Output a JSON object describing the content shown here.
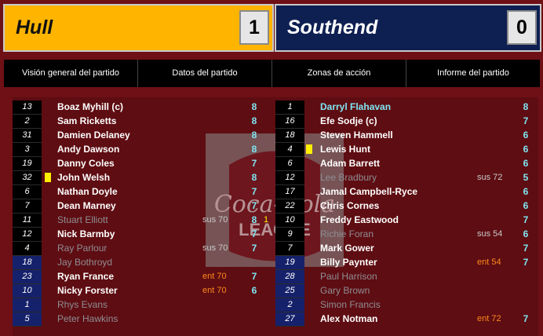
{
  "match": {
    "home": {
      "team": "Hull",
      "score": "1",
      "color": "#ffb400"
    },
    "away": {
      "team": "Southend",
      "score": "0",
      "color": "#0e1f52"
    }
  },
  "tabs": [
    "Visión general del partido",
    "Datos del partido",
    "Zonas de acción",
    "Informe del partido"
  ],
  "home_players": [
    {
      "num": "13",
      "name": "Boaz Myhill (c)",
      "event": "",
      "rating": "8",
      "style": "white",
      "bench": false,
      "card": false
    },
    {
      "num": "2",
      "name": "Sam Ricketts",
      "event": "",
      "rating": "8",
      "style": "white",
      "bench": false,
      "card": false
    },
    {
      "num": "31",
      "name": "Damien Delaney",
      "event": "",
      "rating": "8",
      "style": "white",
      "bench": false,
      "card": false
    },
    {
      "num": "3",
      "name": "Andy Dawson",
      "event": "",
      "rating": "8",
      "style": "white",
      "bench": false,
      "card": false
    },
    {
      "num": "19",
      "name": "Danny Coles",
      "event": "",
      "rating": "7",
      "style": "white",
      "bench": false,
      "card": false
    },
    {
      "num": "32",
      "name": "John Welsh",
      "event": "",
      "rating": "8",
      "style": "white",
      "bench": false,
      "card": true
    },
    {
      "num": "6",
      "name": "Nathan Doyle",
      "event": "",
      "rating": "7",
      "style": "white",
      "bench": false,
      "card": false
    },
    {
      "num": "7",
      "name": "Dean Marney",
      "event": "",
      "rating": "7",
      "style": "white",
      "bench": false,
      "card": false
    },
    {
      "num": "11",
      "name": "Stuart Elliott",
      "event": "sus 70",
      "rating": "8",
      "style": "gray",
      "bench": false,
      "card": false,
      "goal": "1"
    },
    {
      "num": "12",
      "name": "Nick Barmby",
      "event": "",
      "rating": "7",
      "style": "white",
      "bench": false,
      "card": false
    },
    {
      "num": "4",
      "name": "Ray Parlour",
      "event": "sus 70",
      "rating": "7",
      "style": "gray",
      "bench": false,
      "card": false
    },
    {
      "num": "18",
      "name": "Jay Bothroyd",
      "event": "",
      "rating": "",
      "style": "gray",
      "bench": true,
      "card": false
    },
    {
      "num": "23",
      "name": "Ryan France",
      "event": "ent 70",
      "rating": "7",
      "style": "white",
      "bench": true,
      "card": false
    },
    {
      "num": "10",
      "name": "Nicky Forster",
      "event": "ent 70",
      "rating": "6",
      "style": "white",
      "bench": true,
      "card": false
    },
    {
      "num": "1",
      "name": "Rhys Evans",
      "event": "",
      "rating": "",
      "style": "gray",
      "bench": true,
      "card": false
    },
    {
      "num": "5",
      "name": "Peter Hawkins",
      "event": "",
      "rating": "",
      "style": "gray",
      "bench": true,
      "card": false
    }
  ],
  "away_players": [
    {
      "num": "1",
      "name": "Darryl Flahavan",
      "event": "",
      "rating": "8",
      "style": "cyan",
      "bench": false,
      "card": false
    },
    {
      "num": "16",
      "name": "Efe Sodje (c)",
      "event": "",
      "rating": "7",
      "style": "white",
      "bench": false,
      "card": false
    },
    {
      "num": "18",
      "name": "Steven Hammell",
      "event": "",
      "rating": "6",
      "style": "white",
      "bench": false,
      "card": false
    },
    {
      "num": "4",
      "name": "Lewis Hunt",
      "event": "",
      "rating": "6",
      "style": "white",
      "bench": false,
      "card": true
    },
    {
      "num": "6",
      "name": "Adam Barrett",
      "event": "",
      "rating": "6",
      "style": "white",
      "bench": false,
      "card": false
    },
    {
      "num": "12",
      "name": "Lee Bradbury",
      "event": "sus 72",
      "rating": "5",
      "style": "gray",
      "bench": false,
      "card": false
    },
    {
      "num": "17",
      "name": "Jamal Campbell-Ryce",
      "event": "",
      "rating": "6",
      "style": "white",
      "bench": false,
      "card": false
    },
    {
      "num": "22",
      "name": "Chris Cornes",
      "event": "",
      "rating": "6",
      "style": "white",
      "bench": false,
      "card": false
    },
    {
      "num": "10",
      "name": "Freddy Eastwood",
      "event": "",
      "rating": "7",
      "style": "white",
      "bench": false,
      "card": false
    },
    {
      "num": "9",
      "name": "Richie Foran",
      "event": "sus 54",
      "rating": "6",
      "style": "gray",
      "bench": false,
      "card": false
    },
    {
      "num": "7",
      "name": "Mark Gower",
      "event": "",
      "rating": "7",
      "style": "white",
      "bench": false,
      "card": false
    },
    {
      "num": "19",
      "name": "Billy Paynter",
      "event": "ent 54",
      "rating": "7",
      "style": "white",
      "bench": true,
      "card": false
    },
    {
      "num": "28",
      "name": "Paul Harrison",
      "event": "",
      "rating": "",
      "style": "gray",
      "bench": true,
      "card": false
    },
    {
      "num": "25",
      "name": "Gary Brown",
      "event": "",
      "rating": "",
      "style": "gray",
      "bench": true,
      "card": false
    },
    {
      "num": "2",
      "name": "Simon Francis",
      "event": "",
      "rating": "",
      "style": "gray",
      "bench": true,
      "card": false
    },
    {
      "num": "27",
      "name": "Alex Notman",
      "event": "ent 72",
      "rating": "7",
      "style": "white",
      "bench": true,
      "card": false
    }
  ],
  "watermark": {
    "brand": "Coca-Cola",
    "text": "LEAGUE"
  }
}
